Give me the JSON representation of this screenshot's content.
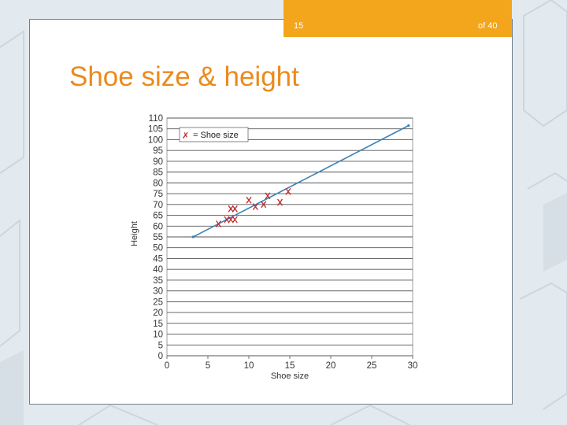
{
  "slide": {
    "title": "Shoe size & height",
    "page_current": "15",
    "page_total": "of 40"
  },
  "colors": {
    "accent_orange": "#f3a51c",
    "title_orange": "#ec8a1c",
    "trend_line": "#3b82b5",
    "marker": "#c0282d"
  },
  "chart_data": {
    "type": "scatter",
    "title": "",
    "xlabel": "Shoe size",
    "ylabel": "Height",
    "xlim": [
      0,
      30
    ],
    "ylim": [
      0,
      110
    ],
    "xticks": [
      0,
      5,
      10,
      15,
      20,
      25,
      30
    ],
    "yticks": [
      0,
      5,
      10,
      15,
      20,
      25,
      30,
      35,
      40,
      45,
      50,
      55,
      60,
      65,
      70,
      75,
      80,
      85,
      90,
      95,
      100,
      105,
      110
    ],
    "grid": "horizontal",
    "legend": {
      "position": "top-left",
      "marker": "✗",
      "label": "= Shoe size"
    },
    "series": [
      {
        "label": "Shoe size",
        "points": [
          [
            6.3,
            61
          ],
          [
            7.3,
            63
          ],
          [
            7.8,
            63
          ],
          [
            8.3,
            63
          ],
          [
            7.8,
            68
          ],
          [
            8.3,
            68
          ],
          [
            10,
            72
          ],
          [
            10.8,
            69
          ],
          [
            11.8,
            70
          ],
          [
            12.3,
            74
          ],
          [
            13.8,
            71
          ],
          [
            14.8,
            76
          ]
        ]
      }
    ],
    "trend_line": {
      "x": [
        3.2,
        29.5
      ],
      "y": [
        55,
        106.5
      ]
    }
  }
}
